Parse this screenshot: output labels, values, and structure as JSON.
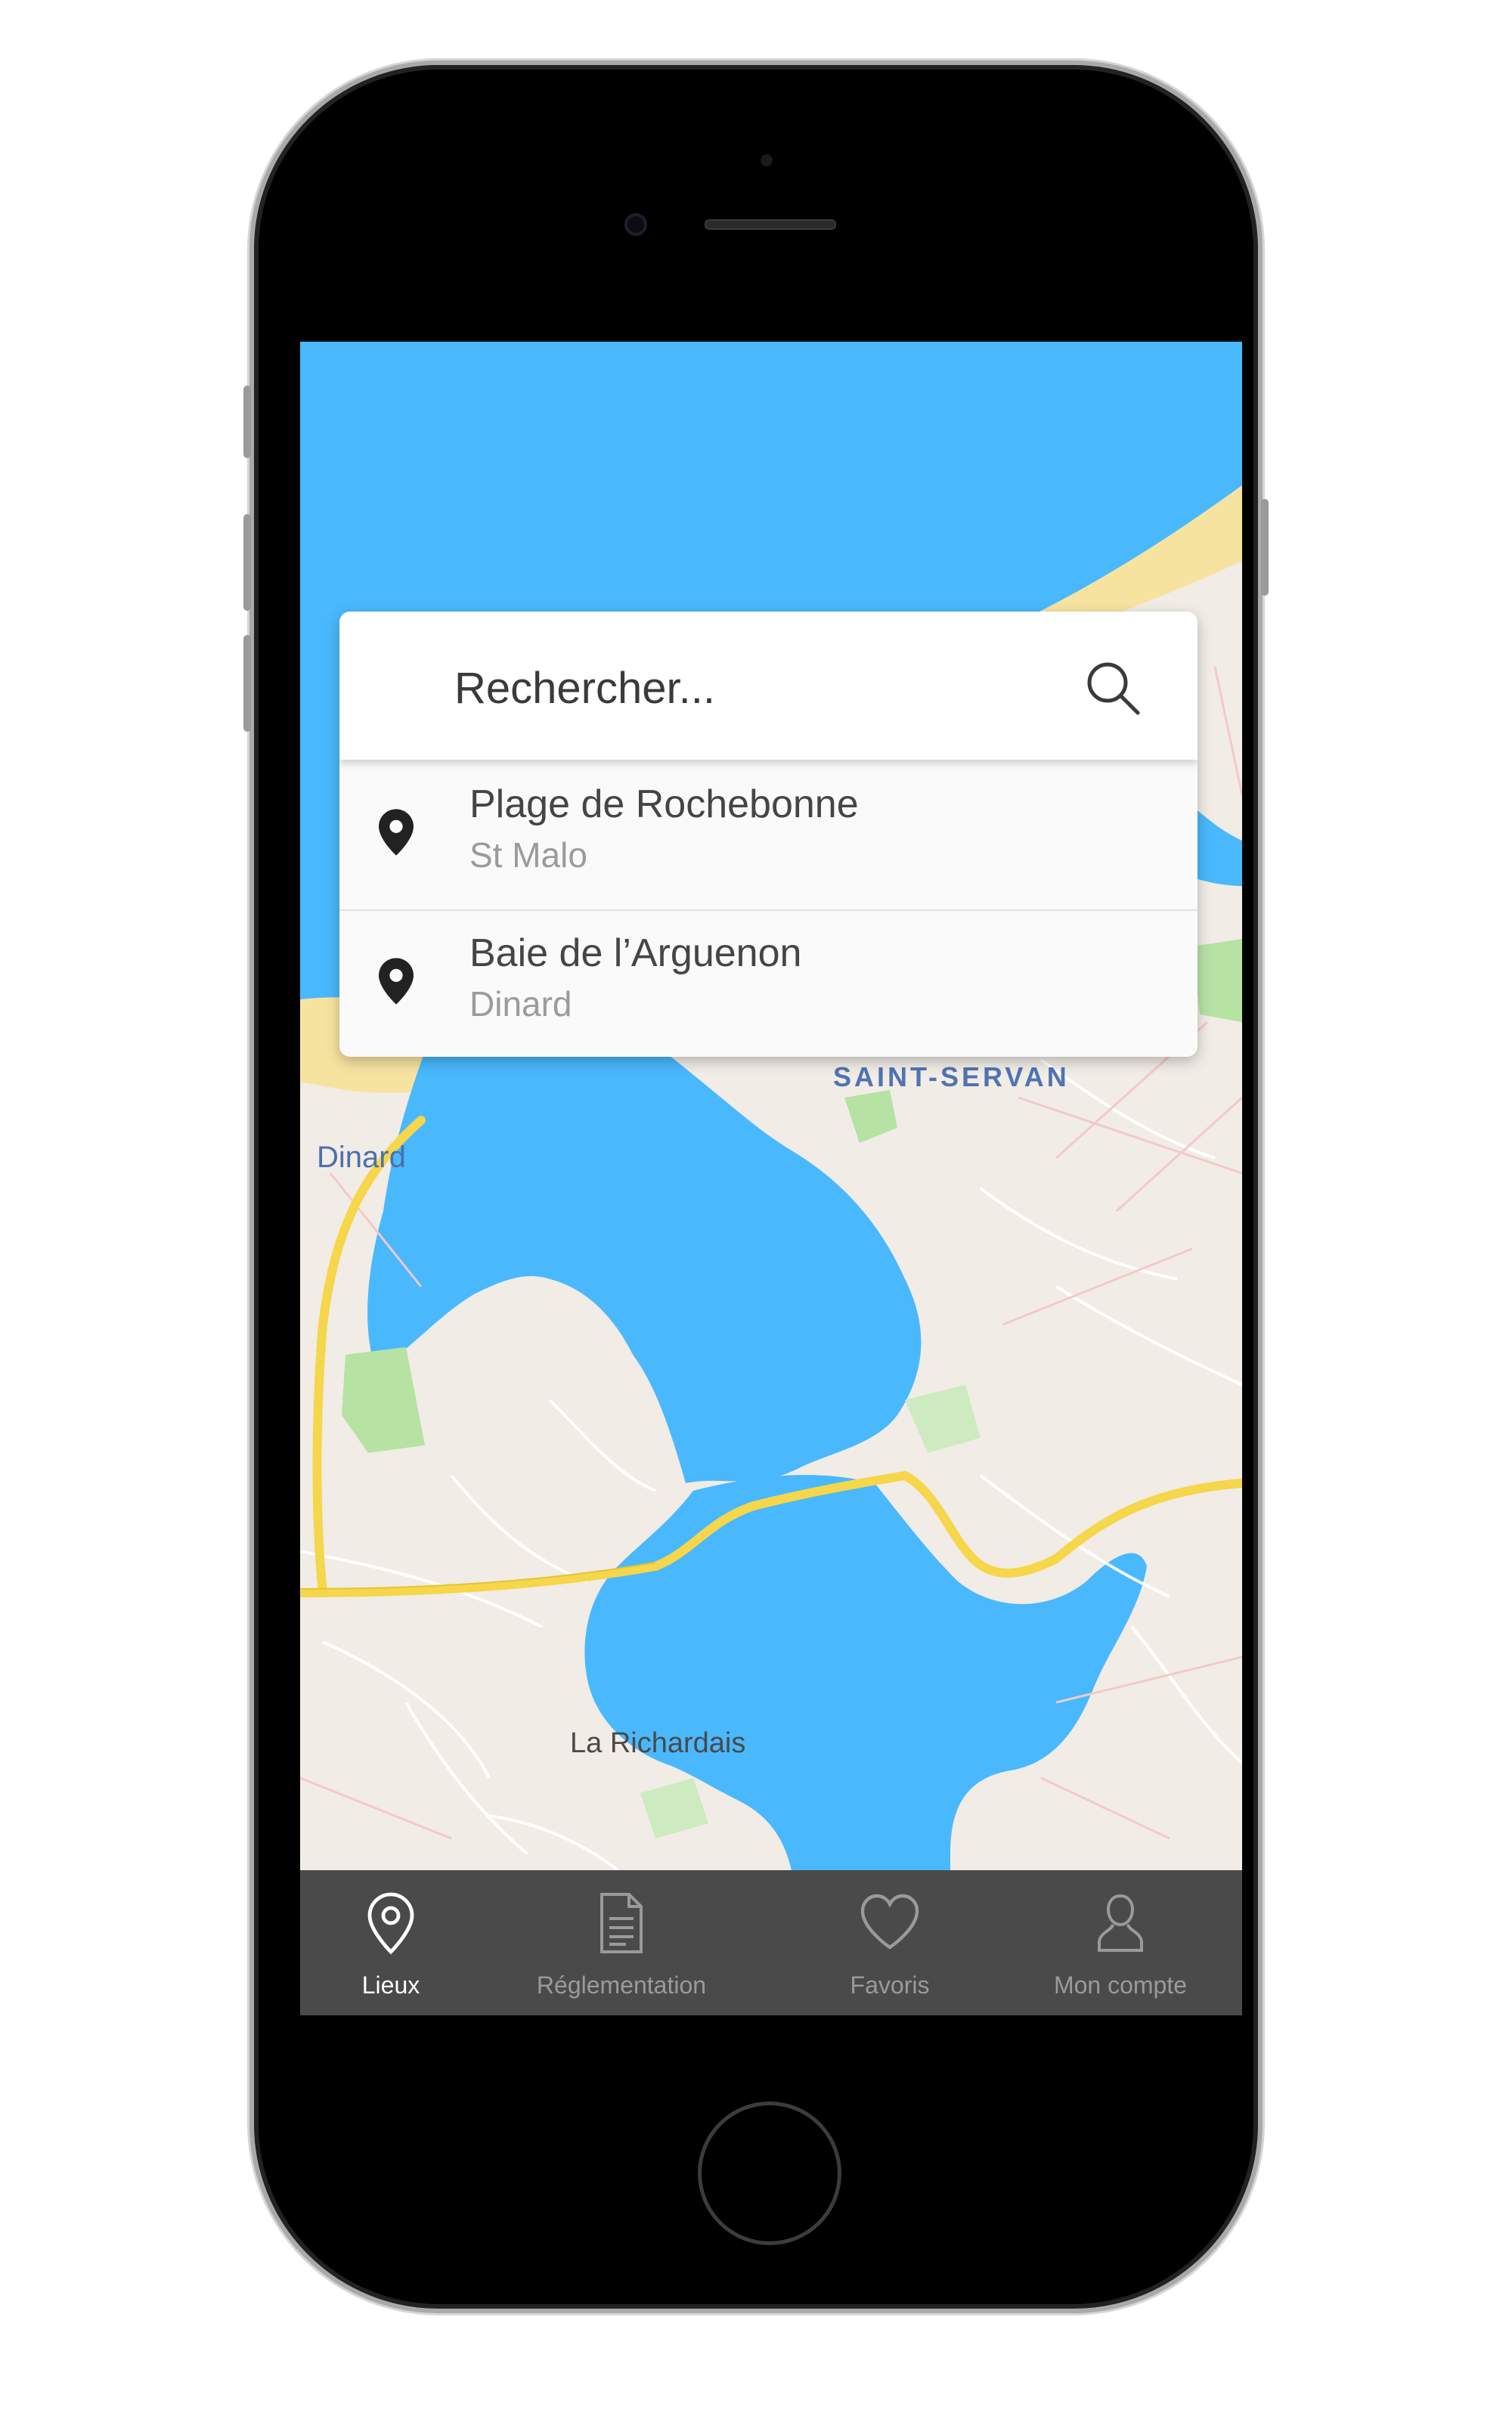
{
  "search": {
    "placeholder": "Rechercher..."
  },
  "results": [
    {
      "title": "Plage de Rochebonne",
      "subtitle": "St Malo",
      "icon": "location-pin-icon"
    },
    {
      "title": "Baie de l’Arguenon",
      "subtitle": "Dinard",
      "icon": "location-pin-icon"
    }
  ],
  "map": {
    "labels": {
      "saint_servan": "SAINT-SERVAN",
      "dinard": "Dinard",
      "la_richardais": "La Richardais"
    }
  },
  "tabs": [
    {
      "label": "Lieux",
      "icon": "location-pin-outline-icon",
      "active": true
    },
    {
      "label": "Réglementation",
      "icon": "document-icon",
      "active": false
    },
    {
      "label": "Favoris",
      "icon": "heart-icon",
      "active": false
    },
    {
      "label": "Mon compte",
      "icon": "user-icon",
      "active": false
    }
  ],
  "colors": {
    "water": "#4ab8fd",
    "land": "#f1ece6",
    "road_major": "#f6d64a",
    "park": "#b6e2a4",
    "tabbar": "#4a4a4a"
  }
}
